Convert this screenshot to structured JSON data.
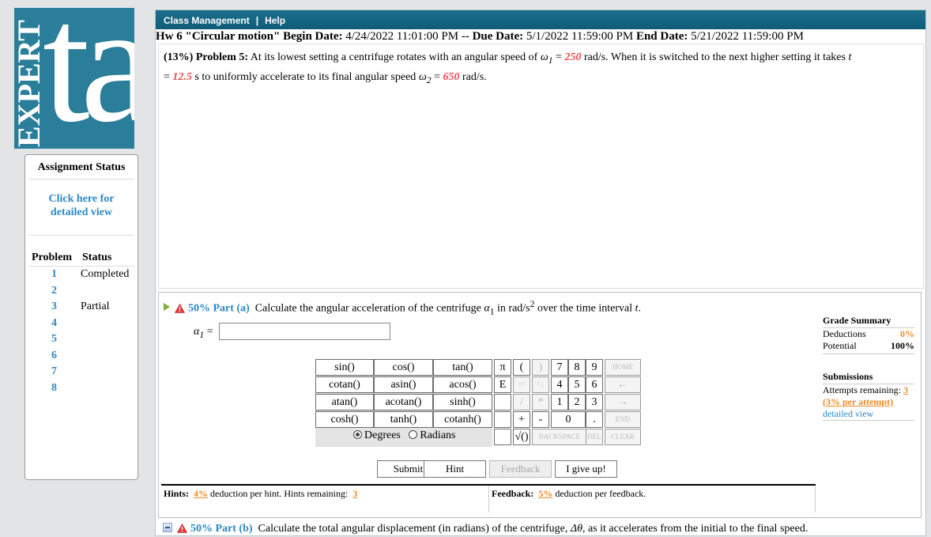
{
  "logo": {
    "text_vertical": "EXPERT",
    "text_big": "ta"
  },
  "sidebar": {
    "title": "Assignment Status",
    "detail_link": "Click here for detailed view",
    "col_problem": "Problem",
    "col_status": "Status",
    "problems": [
      {
        "num": "1",
        "status": "Completed"
      },
      {
        "num": "2",
        "status": ""
      },
      {
        "num": "3",
        "status": "Partial"
      },
      {
        "num": "4",
        "status": ""
      },
      {
        "num": "5",
        "status": ""
      },
      {
        "num": "6",
        "status": ""
      },
      {
        "num": "7",
        "status": ""
      },
      {
        "num": "8",
        "status": ""
      }
    ]
  },
  "topbar": {
    "menu1": "Class Management",
    "separator": "|",
    "menu2": "Help"
  },
  "assignment": {
    "name": "Hw 6 \"Circular motion\"",
    "begin_label": "Begin Date:",
    "begin": "4/24/2022 11:01:00 PM",
    "dash": "--",
    "due_label": "Due Date:",
    "due": "5/1/2022 11:59:00 PM",
    "end_label": "End Date:",
    "end": "5/21/2022 11:59:00 PM"
  },
  "problem": {
    "weight": "(13%)",
    "label": "Problem 5:",
    "text1": "At its lowest setting a centrifuge rotates with an angular speed of ",
    "omega1_sym": "ω",
    "omega1_sub": "1",
    "eq": " = ",
    "omega1_val": "250",
    "text2": " rad/s. When it is switched to the next higher setting it takes ",
    "t_sym": "t",
    "t_val": "12.5",
    "text3": " s to uniformly accelerate to its final angular speed ",
    "omega2_sym": "ω",
    "omega2_sub": "2",
    "omega2_val": "650",
    "text4": " rad/s."
  },
  "part_a": {
    "percent": "50% Part (a)",
    "text1": "Calculate the angular acceleration of the centrifuge ",
    "alpha": "α",
    "alpha_sub": "1",
    "text2": " in rad/s",
    "sup": "2",
    "text3": " over the time interval ",
    "t": "t",
    "period": ".",
    "answer_label": "α",
    "answer_sub": "1",
    "answer_eq": " = ",
    "answer_value": ""
  },
  "calculator": {
    "functions": [
      "sin()",
      "cos()",
      "tan()",
      "cotan()",
      "asin()",
      "acos()",
      "atan()",
      "acotan()",
      "sinh()",
      "cosh()",
      "tanh()",
      "cotanh()"
    ],
    "col_pi": "π",
    "col_e": "E",
    "lparen": "(",
    "rparen": ")",
    "up_caret": "↑^",
    "down_caret": "^↓",
    "slash": "/",
    "star": "*",
    "plus": "+",
    "minus": "-",
    "sqrt": "√()",
    "digits": [
      "7",
      "8",
      "9",
      "4",
      "5",
      "6",
      "1",
      "2",
      "3",
      "0",
      "."
    ],
    "home": "HOME",
    "left": "←",
    "right": "→",
    "end": "END",
    "backspace": "BACKSPACE",
    "del": "DEL",
    "clear": "CLEAR",
    "degrees": "Degrees",
    "radians": "Radians"
  },
  "actions": {
    "submit": "Submit",
    "hint": "Hint",
    "feedback": "Feedback",
    "give_up": "I give up!"
  },
  "hints": {
    "label": "Hints:",
    "pct": "4%",
    "text": " deduction per hint. Hints remaining:",
    "remaining": "3"
  },
  "feedback": {
    "label": "Feedback:",
    "pct": "5%",
    "text": " deduction per feedback."
  },
  "grade_summary": {
    "title": "Grade Summary",
    "deductions_label": "Deductions",
    "deductions": "0%",
    "potential_label": "Potential",
    "potential": "100%",
    "submissions_title": "Submissions",
    "attempts_label": "Attempts remaining:",
    "attempts": "3",
    "per_attempt": "(3% per attempt)",
    "detailed_view": "detailed view"
  },
  "part_b": {
    "percent": "50% Part (b)",
    "text1": "Calculate the total angular displacement (in radians) of the centrifuge, ",
    "delta": "Δθ",
    "text2": ", as it accelerates from the initial to the final speed."
  },
  "colors": {
    "brand": "#2a7e99",
    "link": "#2e88c4",
    "highlight": "#ef4b4b",
    "orange": "#f08a24"
  }
}
